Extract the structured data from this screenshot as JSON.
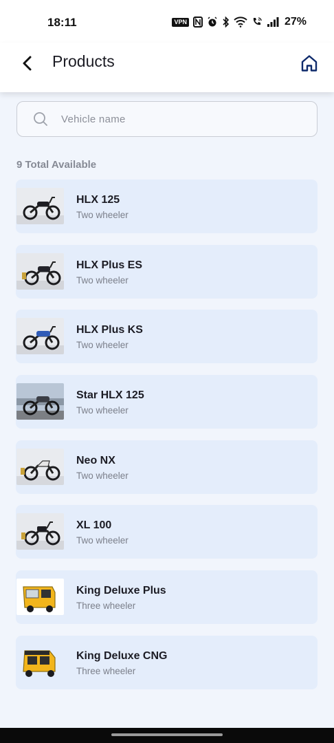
{
  "status_bar": {
    "time": "18:11",
    "vpn_label": "VPN",
    "battery": "27%"
  },
  "header": {
    "title": "Products",
    "back_icon": "chevron-left-icon",
    "home_icon": "home-icon"
  },
  "search": {
    "placeholder": "Vehicle name",
    "value": ""
  },
  "list": {
    "total_text": "9 Total Available",
    "items": [
      {
        "name": "HLX 125",
        "type": "Two wheeler",
        "thumb": "bike"
      },
      {
        "name": "HLX Plus ES",
        "type": "Two wheeler",
        "thumb": "bike"
      },
      {
        "name": "HLX Plus KS",
        "type": "Two wheeler",
        "thumb": "bike-blue"
      },
      {
        "name": "Star HLX 125",
        "type": "Two wheeler",
        "thumb": "bike-outdoor"
      },
      {
        "name": "Neo NX",
        "type": "Two wheeler",
        "thumb": "bike"
      },
      {
        "name": "XL 100",
        "type": "Two wheeler",
        "thumb": "bike"
      },
      {
        "name": "King Deluxe Plus",
        "type": "Three wheeler",
        "thumb": "auto-rickshaw"
      },
      {
        "name": "King Deluxe CNG",
        "type": "Three wheeler",
        "thumb": "auto-rickshaw"
      }
    ]
  },
  "colors": {
    "accent": "#0e2a6b",
    "card_bg": "#e4edfb",
    "page_bg": "#f1f5fc"
  }
}
